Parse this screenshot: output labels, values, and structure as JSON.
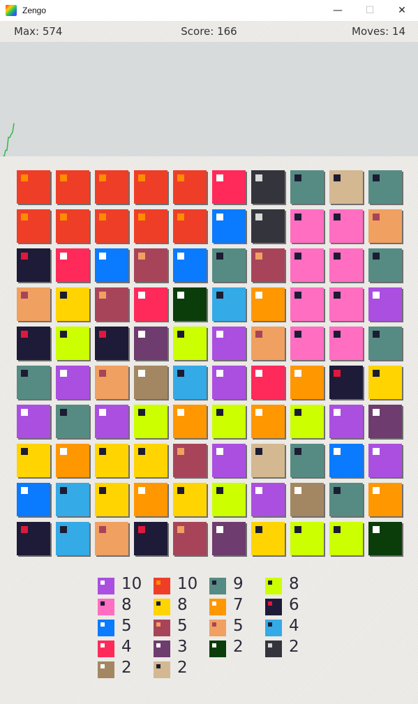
{
  "window": {
    "title": "Zengo",
    "minimize_glyph": "—",
    "maximize_glyph": "☐",
    "close_glyph": "✕"
  },
  "status": {
    "max": "Max: 574",
    "score": "Score: 166",
    "moves": "Moves: 14"
  },
  "palette": {
    "purple": {
      "color": "#ab4fe0",
      "dot": "#ffffff"
    },
    "red": {
      "color": "#ee3e28",
      "dot": "#ff8c00"
    },
    "teal": {
      "color": "#568b83",
      "dot": "#1c1c32"
    },
    "lime": {
      "color": "#ccff00",
      "dot": "#1c1c32"
    },
    "pink": {
      "color": "#ff6ec1",
      "dot": "#1c1c32"
    },
    "yellow": {
      "color": "#ffd400",
      "dot": "#1c1c32"
    },
    "orange": {
      "color": "#ff9700",
      "dot": "#ffffff"
    },
    "navy": {
      "color": "#1d1b38",
      "dot": "#e0183c"
    },
    "blue": {
      "color": "#0a7aff",
      "dot": "#ffffff"
    },
    "rose": {
      "color": "#a8445a",
      "dot": "#f0a060"
    },
    "peach": {
      "color": "#f0a060",
      "dot": "#a8445a"
    },
    "cyan": {
      "color": "#34aae6",
      "dot": "#1c1c32"
    },
    "crimson": {
      "color": "#ff2a5a",
      "dot": "#ffffff"
    },
    "plum": {
      "color": "#6e3c6e",
      "dot": "#ffffff"
    },
    "forest": {
      "color": "#0b3d0b",
      "dot": "#ffffff"
    },
    "charcoal": {
      "color": "#34343c",
      "dot": "#d8d8d8"
    },
    "brown": {
      "color": "#a38763",
      "dot": "#ffffff"
    },
    "tan": {
      "color": "#d4b892",
      "dot": "#1c1c32"
    }
  },
  "board": [
    [
      "red",
      "red",
      "red",
      "red",
      "red",
      "crimson",
      "charcoal",
      "teal",
      "tan",
      "teal"
    ],
    [
      "red",
      "red",
      "red",
      "red",
      "red",
      "blue",
      "charcoal",
      "pink",
      "pink",
      "peach"
    ],
    [
      "navy",
      "crimson",
      "blue",
      "rose",
      "blue",
      "teal",
      "rose",
      "pink",
      "pink",
      "teal"
    ],
    [
      "peach",
      "yellow",
      "rose",
      "crimson",
      "forest",
      "cyan",
      "orange",
      "pink",
      "pink",
      "purple"
    ],
    [
      "navy",
      "lime",
      "navy",
      "plum",
      "lime",
      "purple",
      "peach",
      "pink",
      "pink",
      "teal"
    ],
    [
      "teal",
      "purple",
      "peach",
      "brown",
      "cyan",
      "purple",
      "crimson",
      "orange",
      "navy",
      "yellow"
    ],
    [
      "purple",
      "teal",
      "purple",
      "lime",
      "orange",
      "lime",
      "orange",
      "lime",
      "purple",
      "plum"
    ],
    [
      "yellow",
      "orange",
      "yellow",
      "yellow",
      "rose",
      "purple",
      "tan",
      "teal",
      "blue",
      "purple"
    ],
    [
      "blue",
      "cyan",
      "yellow",
      "orange",
      "yellow",
      "lime",
      "purple",
      "brown",
      "teal",
      "orange"
    ],
    [
      "navy",
      "cyan",
      "peach",
      "navy",
      "rose",
      "plum",
      "yellow",
      "lime",
      "lime",
      "forest"
    ]
  ],
  "legend": [
    {
      "tile": "purple",
      "count": "10"
    },
    {
      "tile": "red",
      "count": "10"
    },
    {
      "tile": "teal",
      "count": "9"
    },
    {
      "tile": "lime",
      "count": "8"
    },
    {
      "tile": "pink",
      "count": "8"
    },
    {
      "tile": "yellow",
      "count": "8"
    },
    {
      "tile": "orange",
      "count": "7"
    },
    {
      "tile": "navy",
      "count": "6"
    },
    {
      "tile": "blue",
      "count": "5"
    },
    {
      "tile": "rose",
      "count": "5"
    },
    {
      "tile": "peach",
      "count": "5"
    },
    {
      "tile": "cyan",
      "count": "4"
    },
    {
      "tile": "crimson",
      "count": "4"
    },
    {
      "tile": "plum",
      "count": "3"
    },
    {
      "tile": "forest",
      "count": "2"
    },
    {
      "tile": "charcoal",
      "count": "2"
    },
    {
      "tile": "brown",
      "count": "2"
    },
    {
      "tile": "tan",
      "count": "2"
    }
  ],
  "score_history": {
    "color": "#2fb84a",
    "values": [
      0,
      0,
      30,
      30,
      95,
      95,
      110,
      120,
      166
    ]
  }
}
